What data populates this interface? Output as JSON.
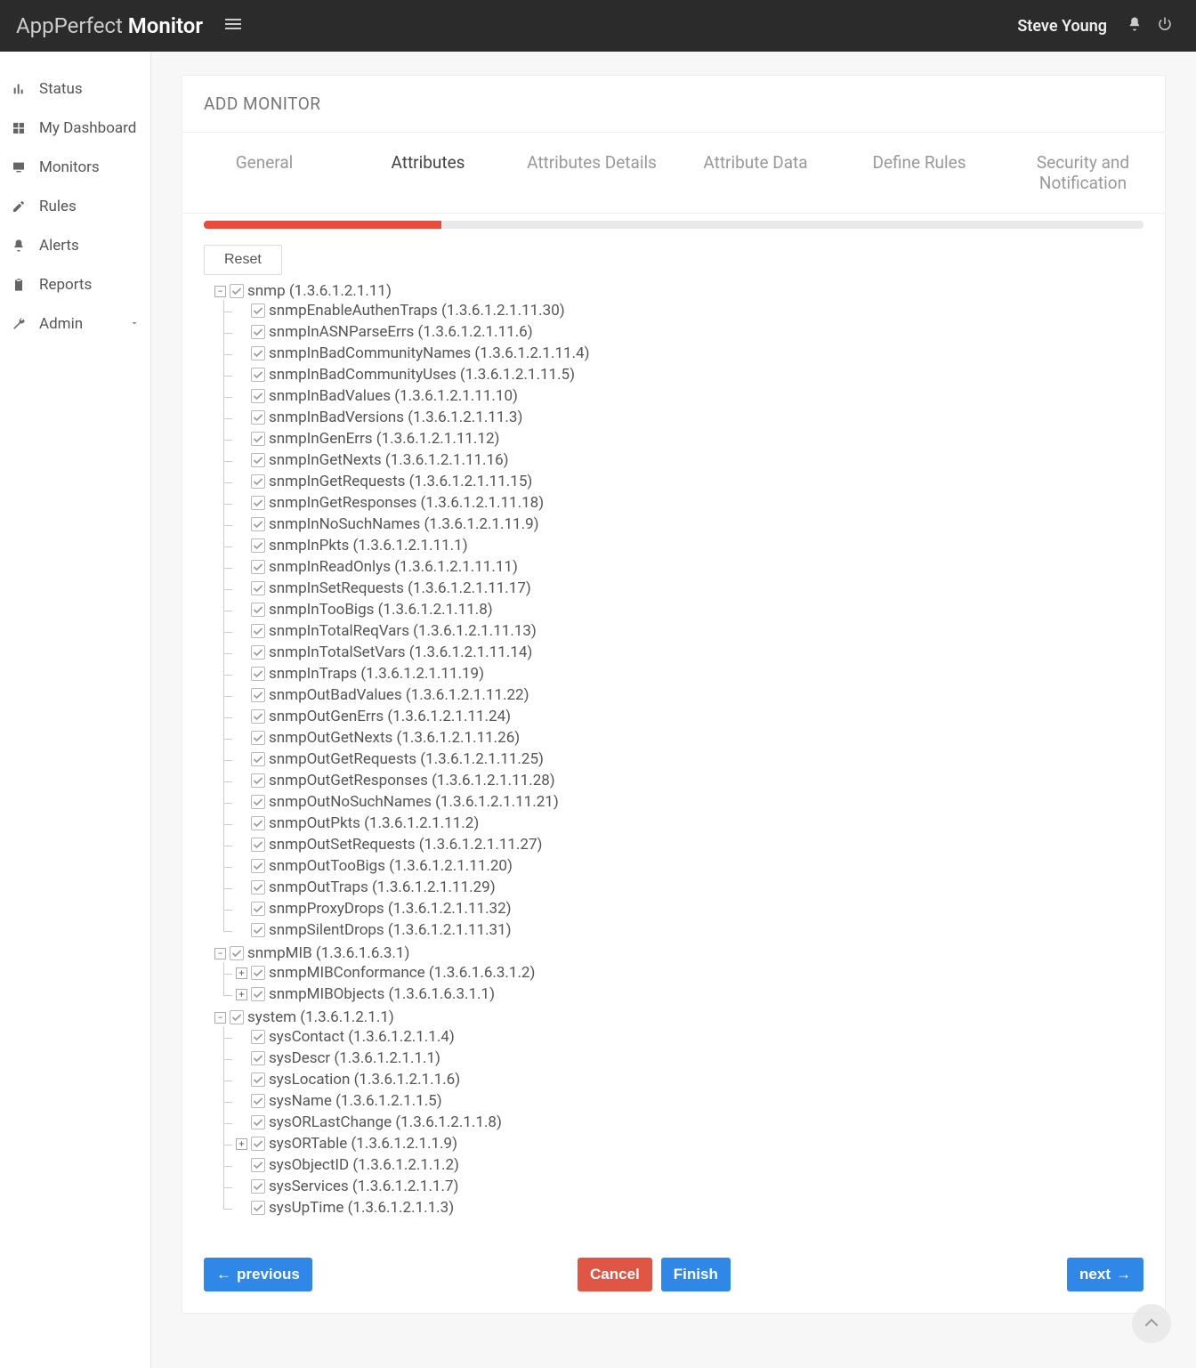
{
  "header": {
    "brandPrefix": "AppPerfect",
    "brandSuffix": "Monitor",
    "user": "Steve Young"
  },
  "sidebar": {
    "items": [
      {
        "label": "Status",
        "icon": "bar-chart-icon"
      },
      {
        "label": "My Dashboard",
        "icon": "grid-icon"
      },
      {
        "label": "Monitors",
        "icon": "monitor-icon"
      },
      {
        "label": "Rules",
        "icon": "pencil-icon"
      },
      {
        "label": "Alerts",
        "icon": "bell-icon"
      },
      {
        "label": "Reports",
        "icon": "clipboard-icon"
      },
      {
        "label": "Admin",
        "icon": "wrench-icon",
        "expandable": true
      }
    ]
  },
  "page": {
    "title": "ADD MONITOR",
    "resetLabel": "Reset",
    "progressPercent": 25.3
  },
  "wizard": {
    "tabs": [
      "General",
      "Attributes",
      "Attributes Details",
      "Attribute Data",
      "Define Rules",
      "Security and Notification"
    ],
    "activeIndex": 1
  },
  "tree": [
    {
      "label": "snmp (1.3.6.1.2.1.11)",
      "state": "minus",
      "children": [
        {
          "label": "snmpEnableAuthenTraps (1.3.6.1.2.1.11.30)"
        },
        {
          "label": "snmpInASNParseErrs (1.3.6.1.2.1.11.6)"
        },
        {
          "label": "snmpInBadCommunityNames (1.3.6.1.2.1.11.4)"
        },
        {
          "label": "snmpInBadCommunityUses (1.3.6.1.2.1.11.5)"
        },
        {
          "label": "snmpInBadValues (1.3.6.1.2.1.11.10)"
        },
        {
          "label": "snmpInBadVersions (1.3.6.1.2.1.11.3)"
        },
        {
          "label": "snmpInGenErrs (1.3.6.1.2.1.11.12)"
        },
        {
          "label": "snmpInGetNexts (1.3.6.1.2.1.11.16)"
        },
        {
          "label": "snmpInGetRequests (1.3.6.1.2.1.11.15)"
        },
        {
          "label": "snmpInGetResponses (1.3.6.1.2.1.11.18)"
        },
        {
          "label": "snmpInNoSuchNames (1.3.6.1.2.1.11.9)"
        },
        {
          "label": "snmpInPkts (1.3.6.1.2.1.11.1)"
        },
        {
          "label": "snmpInReadOnlys (1.3.6.1.2.1.11.11)"
        },
        {
          "label": "snmpInSetRequests (1.3.6.1.2.1.11.17)"
        },
        {
          "label": "snmpInTooBigs (1.3.6.1.2.1.11.8)"
        },
        {
          "label": "snmpInTotalReqVars (1.3.6.1.2.1.11.13)"
        },
        {
          "label": "snmpInTotalSetVars (1.3.6.1.2.1.11.14)"
        },
        {
          "label": "snmpInTraps (1.3.6.1.2.1.11.19)"
        },
        {
          "label": "snmpOutBadValues (1.3.6.1.2.1.11.22)"
        },
        {
          "label": "snmpOutGenErrs (1.3.6.1.2.1.11.24)"
        },
        {
          "label": "snmpOutGetNexts (1.3.6.1.2.1.11.26)"
        },
        {
          "label": "snmpOutGetRequests (1.3.6.1.2.1.11.25)"
        },
        {
          "label": "snmpOutGetResponses (1.3.6.1.2.1.11.28)"
        },
        {
          "label": "snmpOutNoSuchNames (1.3.6.1.2.1.11.21)"
        },
        {
          "label": "snmpOutPkts (1.3.6.1.2.1.11.2)"
        },
        {
          "label": "snmpOutSetRequests (1.3.6.1.2.1.11.27)"
        },
        {
          "label": "snmpOutTooBigs (1.3.6.1.2.1.11.20)"
        },
        {
          "label": "snmpOutTraps (1.3.6.1.2.1.11.29)"
        },
        {
          "label": "snmpProxyDrops (1.3.6.1.2.1.11.32)"
        },
        {
          "label": "snmpSilentDrops (1.3.6.1.2.1.11.31)"
        }
      ]
    },
    {
      "label": "snmpMIB (1.3.6.1.6.3.1)",
      "state": "minus",
      "children": [
        {
          "label": "snmpMIBConformance (1.3.6.1.6.3.1.2)",
          "state": "plus"
        },
        {
          "label": "snmpMIBObjects (1.3.6.1.6.3.1.1)",
          "state": "plus"
        }
      ]
    },
    {
      "label": "system (1.3.6.1.2.1.1)",
      "state": "minus",
      "children": [
        {
          "label": "sysContact (1.3.6.1.2.1.1.4)"
        },
        {
          "label": "sysDescr (1.3.6.1.2.1.1.1)"
        },
        {
          "label": "sysLocation (1.3.6.1.2.1.1.6)"
        },
        {
          "label": "sysName (1.3.6.1.2.1.1.5)"
        },
        {
          "label": "sysORLastChange (1.3.6.1.2.1.1.8)"
        },
        {
          "label": "sysORTable (1.3.6.1.2.1.1.9)",
          "state": "plus"
        },
        {
          "label": "sysObjectID (1.3.6.1.2.1.1.2)"
        },
        {
          "label": "sysServices (1.3.6.1.2.1.1.7)"
        },
        {
          "label": "sysUpTime (1.3.6.1.2.1.1.3)"
        }
      ]
    }
  ],
  "footer": {
    "previous": "previous",
    "cancel": "Cancel",
    "finish": "Finish",
    "next": "next"
  }
}
